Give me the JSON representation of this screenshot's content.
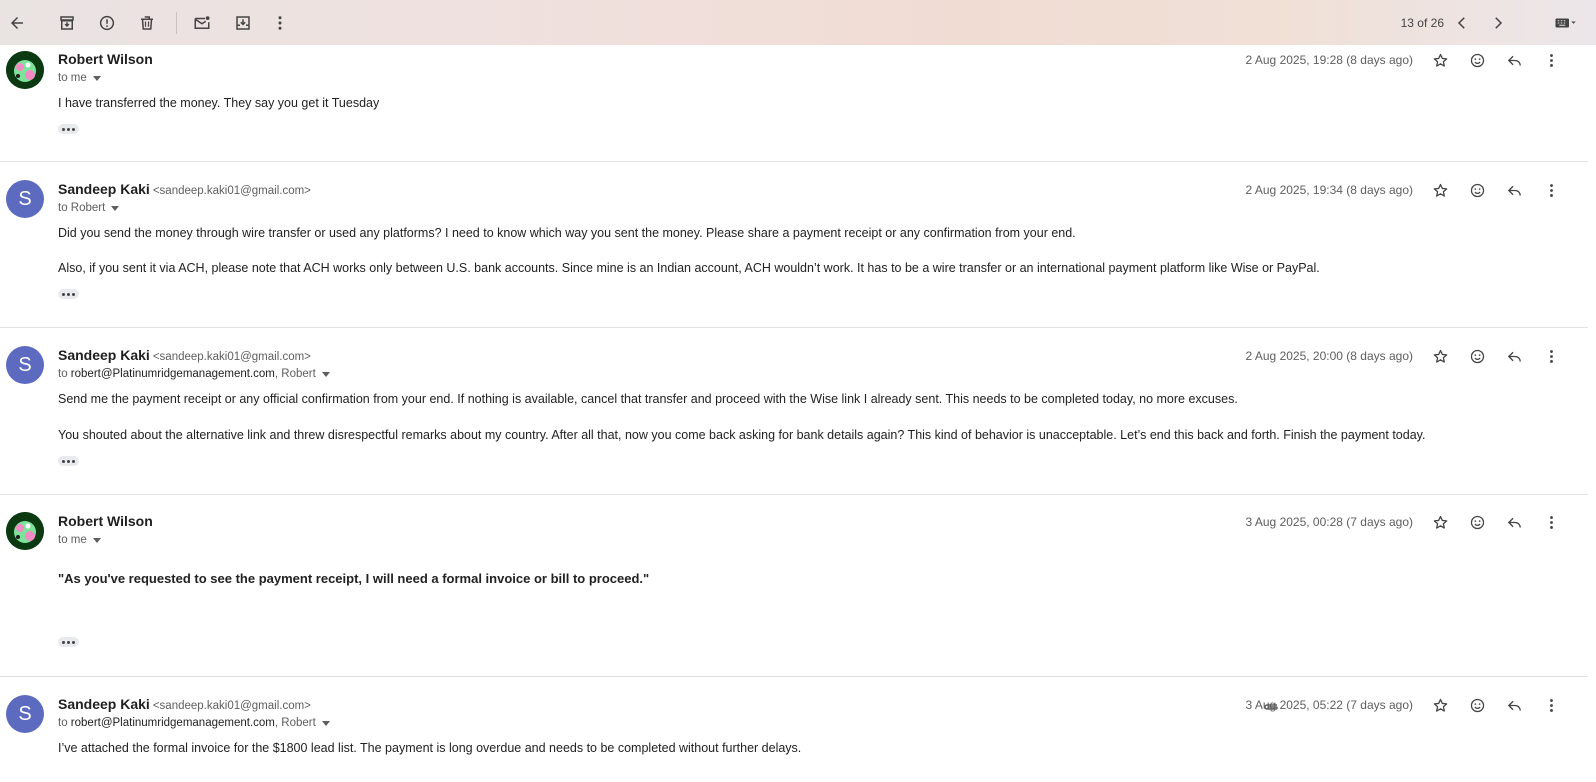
{
  "toolbar": {
    "pager": "13 of 26",
    "icons": [
      "back-arrow-icon",
      "archive-icon",
      "report-spam-icon",
      "delete-icon",
      "mark-unread-icon",
      "move-to-icon",
      "more-vert-icon",
      "newer-chevron-icon",
      "older-chevron-icon",
      "keyboard-icon"
    ]
  },
  "colors": {
    "avatar_letter_bg": "#5c6bc0",
    "toolbar_gradient": "#efe1df"
  },
  "messages": [
    {
      "sender": "Robert Wilson",
      "email": "",
      "avatar": "picture",
      "to_prefix": "to",
      "to": "me",
      "to_extra": "",
      "date": "2 Aug 2025, 19:28 (8 days ago)",
      "paragraphs": [
        "I have transferred the money. They say you get it Tuesday"
      ]
    },
    {
      "sender": "Sandeep Kaki",
      "email": "<sandeep.kaki01@gmail.com>",
      "avatar": "S",
      "to_prefix": "to",
      "to": "Robert",
      "to_extra": "",
      "date": "2 Aug 2025, 19:34 (8 days ago)",
      "paragraphs": [
        "Did you send the money through wire transfer or used any platforms? I need to know which way you sent the money. Please share a payment receipt or any confirmation from your end.",
        "Also, if you sent it via ACH, please note that ACH works only between U.S. bank accounts. Since mine is an Indian account, ACH wouldn’t work. It has to be a wire transfer or an international payment platform like Wise or PayPal."
      ]
    },
    {
      "sender": "Sandeep Kaki",
      "email": "<sandeep.kaki01@gmail.com>",
      "avatar": "S",
      "to_prefix": "to",
      "to": "robert@Platinumridgemanagement.com",
      "to_extra": ", Robert",
      "date": "2 Aug 2025, 20:00 (8 days ago)",
      "paragraphs": [
        "Send me the payment receipt or any official confirmation from your end. If nothing is available, cancel that transfer and proceed with the Wise link I already sent. This needs to be completed today, no more excuses.",
        "You shouted about the alternative link and threw disrespectful remarks about my country. After all that, now you come back asking for bank details again? This kind of behavior is unacceptable. Let’s end this back and forth. Finish the payment today."
      ]
    },
    {
      "sender": "Robert Wilson",
      "email": "",
      "avatar": "picture",
      "to_prefix": "to",
      "to": "me",
      "to_extra": "",
      "date": "3 Aug 2025, 00:28 (7 days ago)",
      "paragraphs": [
        "\"As you've requested to see the payment receipt, I will need a formal invoice or bill to proceed.\""
      ]
    },
    {
      "sender": "Sandeep Kaki",
      "email": "<sandeep.kaki01@gmail.com>",
      "avatar": "S",
      "to_prefix": "to",
      "to": "robert@Platinumridgemanagement.com",
      "to_extra": ", Robert",
      "date": "3 Aug 2025, 05:22 (7 days ago)",
      "attachment_icon": "paperclip-icon",
      "paragraphs": [
        "I’ve attached the formal invoice for the $1800 lead list. The payment is long overdue and needs to be completed without further delays."
      ]
    }
  ]
}
